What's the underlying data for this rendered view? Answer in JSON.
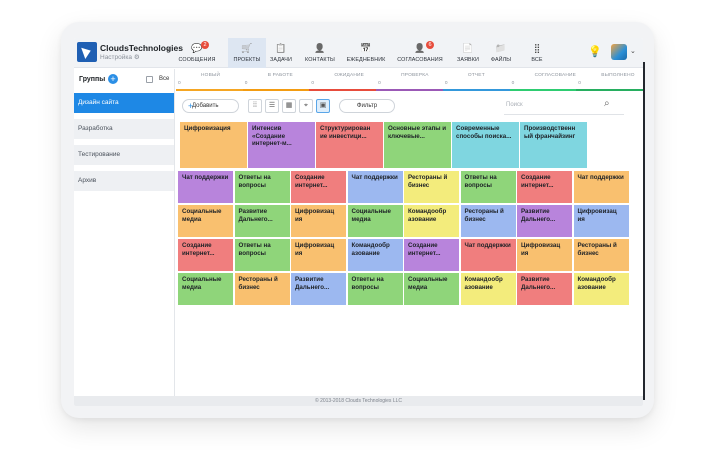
{
  "app": {
    "company": "CloudsTechnologies",
    "settings_label": "Настройка",
    "footer": "© 2013-2018 Clouds Technologies LLC"
  },
  "nav": [
    {
      "label": "СООБЩЕНИЯ",
      "icon": "chat-icon",
      "badge": "2"
    },
    {
      "label": "ПРОЕКТЫ",
      "icon": "cart-icon",
      "badge": ""
    },
    {
      "label": "ЗАДАЧИ",
      "icon": "clipboard-icon",
      "badge": ""
    },
    {
      "label": "КОНТАКТЫ",
      "icon": "person-icon",
      "badge": ""
    },
    {
      "label": "ЕЖЕДНЕВНИК",
      "icon": "calendar-icon",
      "badge": ""
    },
    {
      "label": "СОГЛАСОВАНИЯ",
      "icon": "approval-icon",
      "badge": "6"
    },
    {
      "label": "ЗАЯВКИ",
      "icon": "document-icon",
      "badge": ""
    },
    {
      "label": "ФАЙЛЫ",
      "icon": "folder-icon",
      "badge": ""
    },
    {
      "label": "ВСЕ",
      "icon": "grid-icon",
      "badge": ""
    }
  ],
  "sidebar": {
    "title": "Группы",
    "all_label": "Все",
    "groups": [
      "Дизайн сайта",
      "Разработка",
      "Тестирование",
      "Архив"
    ]
  },
  "statuses": [
    {
      "label": "НОВЫЙ",
      "count": "0",
      "color": "#f5a623"
    },
    {
      "label": "В РАБОТЕ",
      "count": "0",
      "color": "#f39c12"
    },
    {
      "label": "ОЖИДАНИЕ",
      "count": "0",
      "color": "#e74c3c"
    },
    {
      "label": "ПРОВЕРКА",
      "count": "0",
      "color": "#9b59b6"
    },
    {
      "label": "ОТЧЕТ",
      "count": "0",
      "color": "#3498db"
    },
    {
      "label": "СОГЛАСОВАНИЕ",
      "count": "0",
      "color": "#2ecc71"
    },
    {
      "label": "ВЫПОЛНЕНО",
      "count": "0",
      "color": "#27ae60"
    }
  ],
  "toolbar": {
    "add_label": "Добавить",
    "filter_label": "Фильтр",
    "search_placeholder": "Поиск"
  },
  "colors": {
    "orange": "#f9c06f",
    "purple": "#b884dc",
    "red": "#f07e7e",
    "green": "#8fd57a",
    "cyan": "#7fd6e0",
    "yellow": "#f3ec7c",
    "blue": "#9cb8f0",
    "accent": "#1e88e5"
  },
  "top_cards": [
    {
      "text": "Цифровизация",
      "color": "orange"
    },
    {
      "text": "Интенсив «Создание интернет-м...",
      "color": "purple"
    },
    {
      "text": "Структурирован ие инвестици...",
      "color": "red"
    },
    {
      "text": "Основные этапы и ключевые...",
      "color": "green"
    },
    {
      "text": "Современные способы поиска...",
      "color": "cyan"
    },
    {
      "text": "Производственн ый франчайзинг",
      "color": "cyan"
    }
  ],
  "grid_cards": [
    [
      {
        "text": "Чат поддержки",
        "color": "purple"
      },
      {
        "text": "Ответы на вопросы",
        "color": "green"
      },
      {
        "text": "Создание интернет...",
        "color": "red"
      },
      {
        "text": "Чат поддержки",
        "color": "blue"
      },
      {
        "text": "Рестораны й бизнес",
        "color": "yellow"
      },
      {
        "text": "Ответы на вопросы",
        "color": "green"
      },
      {
        "text": "Создание интернет...",
        "color": "red"
      },
      {
        "text": "Чат поддержки",
        "color": "orange"
      }
    ],
    [
      {
        "text": "Социальные медиа",
        "color": "orange"
      },
      {
        "text": "Развитие Дальнего...",
        "color": "green"
      },
      {
        "text": "Цифровизац ия",
        "color": "orange"
      },
      {
        "text": "Социальные медиа",
        "color": "green"
      },
      {
        "text": "Командообр азование",
        "color": "yellow"
      },
      {
        "text": "Рестораны й бизнес",
        "color": "blue"
      },
      {
        "text": "Развитие Дальнего...",
        "color": "purple"
      },
      {
        "text": "Цифровизац ия",
        "color": "blue"
      }
    ],
    [
      {
        "text": "Создание интернет...",
        "color": "red"
      },
      {
        "text": "Ответы на вопросы",
        "color": "green"
      },
      {
        "text": "Цифровизац ия",
        "color": "orange"
      },
      {
        "text": "Командообр азование",
        "color": "blue"
      },
      {
        "text": "Создание интернет...",
        "color": "purple"
      },
      {
        "text": "Чат поддержки",
        "color": "red"
      },
      {
        "text": "Цифровизац ия",
        "color": "orange"
      },
      {
        "text": "Рестораны й бизнес",
        "color": "orange"
      }
    ],
    [
      {
        "text": "Социальные медиа",
        "color": "green"
      },
      {
        "text": "Рестораны й бизнес",
        "color": "orange"
      },
      {
        "text": "Развитие Дальнего...",
        "color": "blue"
      },
      {
        "text": "Ответы на вопросы",
        "color": "green"
      },
      {
        "text": "Социальные медиа",
        "color": "green"
      },
      {
        "text": "Командообр азование",
        "color": "yellow"
      },
      {
        "text": "Развитие Дальнего...",
        "color": "red"
      },
      {
        "text": "Командообр азование",
        "color": "yellow"
      }
    ]
  ]
}
